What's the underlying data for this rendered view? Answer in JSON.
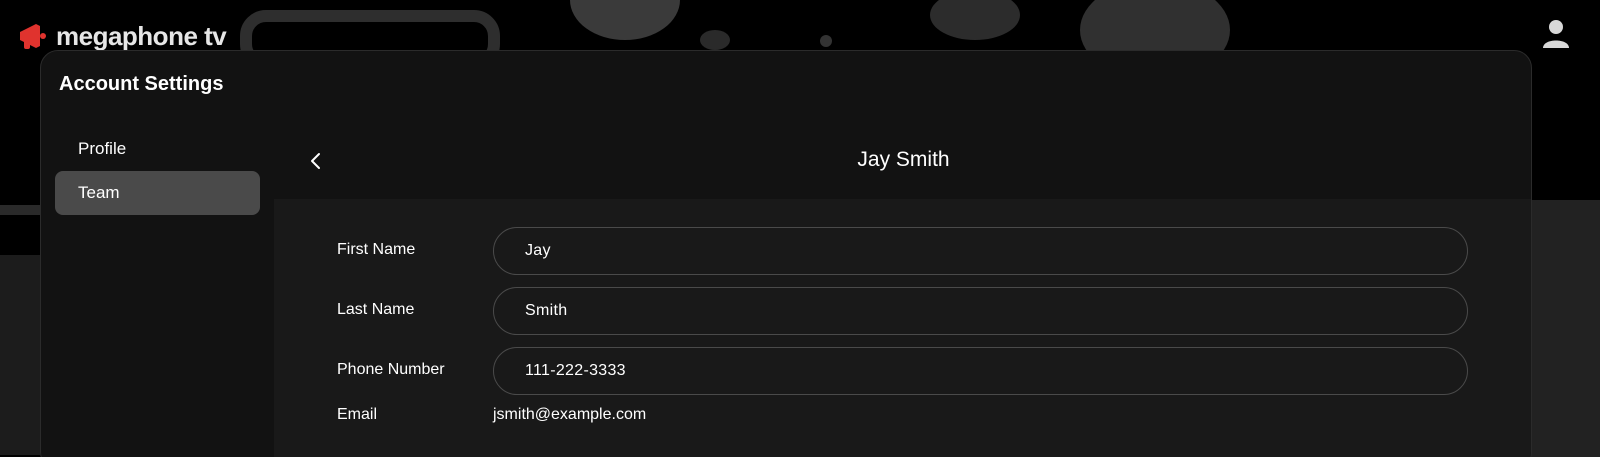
{
  "brand": {
    "name": "megaphone tv",
    "accent": "#e0332e"
  },
  "page": {
    "title": "Account Settings"
  },
  "sidebar": {
    "items": [
      {
        "label": "Profile",
        "active": false
      },
      {
        "label": "Team",
        "active": true
      }
    ]
  },
  "detail": {
    "title": "Jay Smith",
    "fields": {
      "first_name": {
        "label": "First Name",
        "value": "Jay"
      },
      "last_name": {
        "label": "Last Name",
        "value": "Smith"
      },
      "phone": {
        "label": "Phone Number",
        "value": "111-222-3333"
      },
      "email": {
        "label": "Email",
        "value": "jsmith@example.com"
      }
    }
  },
  "icons": {
    "user": "user-icon",
    "back": "chevron-left-icon",
    "logo": "megaphone-icon"
  },
  "colors": {
    "background": "#000000",
    "panel": "#121212",
    "content": "#191919",
    "active_item": "#4a4a4a",
    "field_border": "#4a4a4a"
  }
}
